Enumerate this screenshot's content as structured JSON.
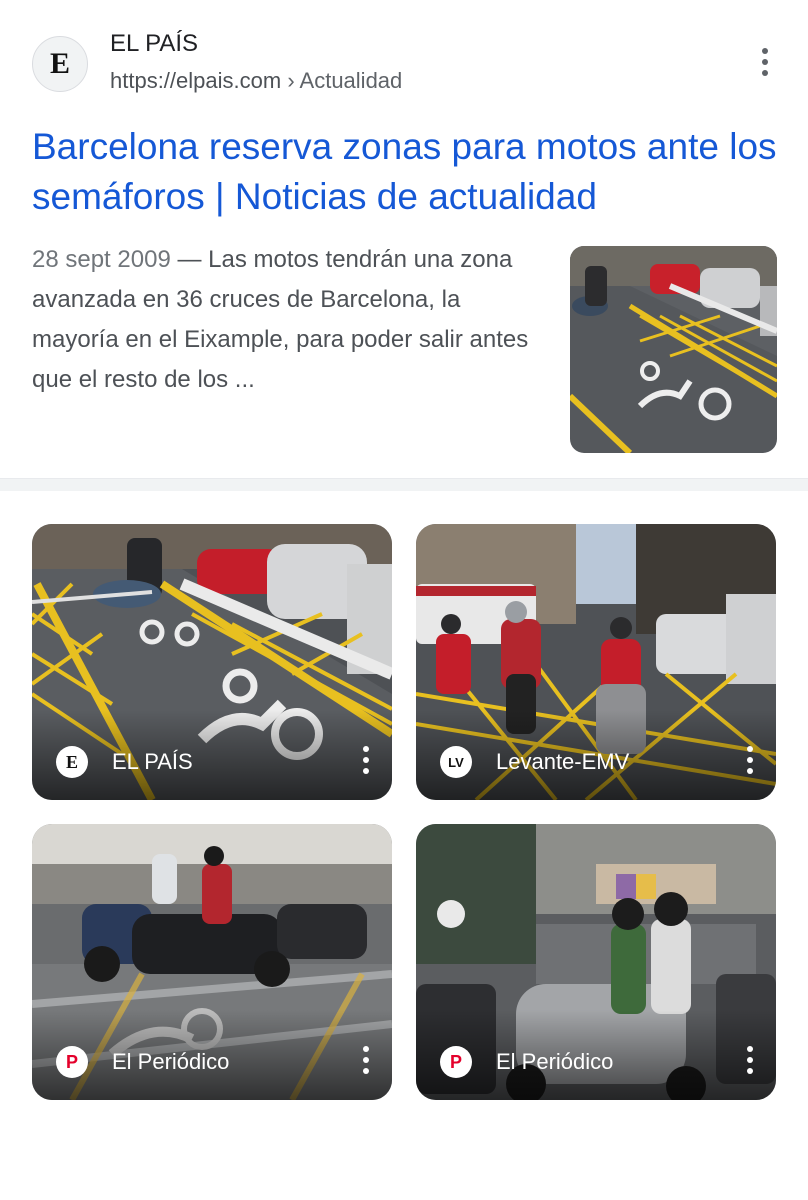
{
  "result": {
    "site_name": "EL PAÍS",
    "url": "https://elpais.com",
    "breadcrumb": "› Actualidad",
    "favicon_letter": "E",
    "title": "Barcelona reserva zonas para motos ante los semáforos | Noticias de actualidad",
    "date": "28 sept 2009",
    "snippet": " — Las motos tendrán una zona avanzada en 36 cruces de Barcelona, la mayoría en el Eixample, para poder salir antes que el resto de los ..."
  },
  "image_cards": [
    {
      "source": "EL PAÍS",
      "icon_letter": "E",
      "icon_color": "#111111"
    },
    {
      "source": "Levante-EMV",
      "icon_letter": "LV",
      "icon_color": "#111111"
    },
    {
      "source": "El Periódico",
      "icon_letter": "P",
      "icon_color": "#e4002b"
    },
    {
      "source": "El Periódico",
      "icon_letter": "P",
      "icon_color": "#e4002b"
    }
  ],
  "colors": {
    "link": "#1558d6",
    "road_marking": "#e8c020",
    "background": "#ffffff"
  }
}
